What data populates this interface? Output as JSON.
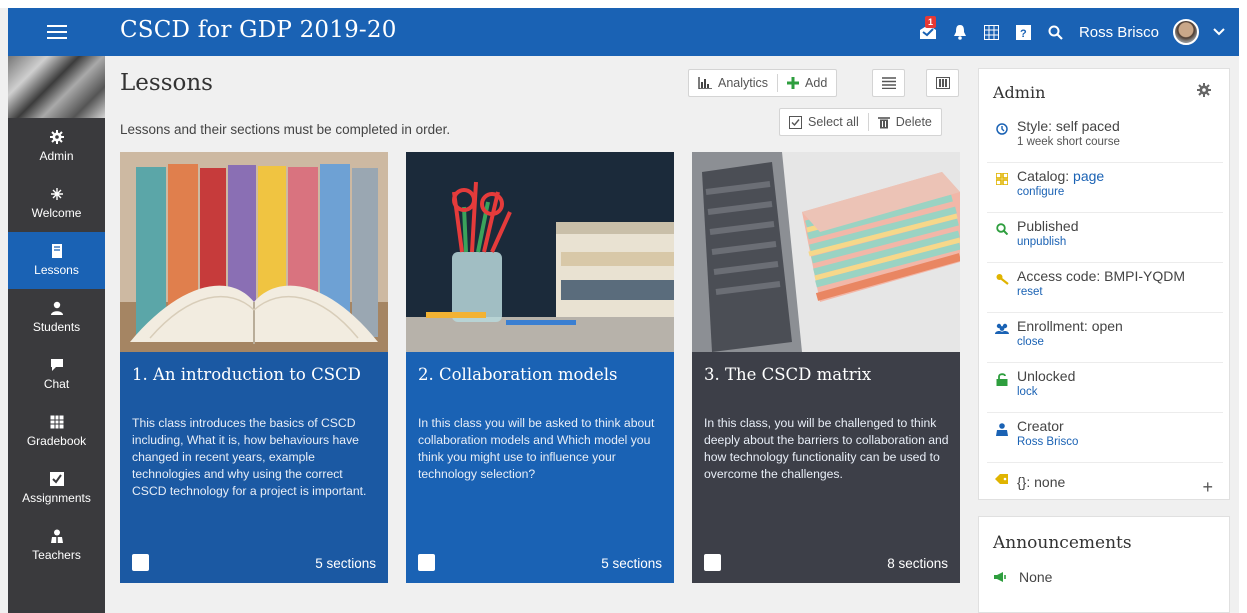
{
  "header": {
    "app_title": "CSCD for GDP 2019-20",
    "notification_count": "1",
    "user_name": "Ross Brisco"
  },
  "sidebar": {
    "items": [
      {
        "label": "Admin",
        "icon": "gear-icon"
      },
      {
        "label": "Welcome",
        "icon": "sparkle-icon"
      },
      {
        "label": "Lessons",
        "icon": "book-icon",
        "active": true
      },
      {
        "label": "Students",
        "icon": "person-icon"
      },
      {
        "label": "Chat",
        "icon": "chat-icon"
      },
      {
        "label": "Gradebook",
        "icon": "grid-icon"
      },
      {
        "label": "Assignments",
        "icon": "checkbox-icon"
      },
      {
        "label": "Teachers",
        "icon": "teacher-icon"
      }
    ]
  },
  "main": {
    "title": "Lessons",
    "subtitle": "Lessons and their sections must be completed in order.",
    "toolbar": {
      "analytics_label": "Analytics",
      "add_label": "Add",
      "select_all_label": "Select all",
      "delete_label": "Delete"
    },
    "lessons": [
      {
        "title": "1. An introduction to CSCD",
        "description": "This class introduces the basics of CSCD including, What it is, how behaviours have changed in recent years, example technologies and why using the correct CSCD technology for a project is important.",
        "sections": "5 sections"
      },
      {
        "title": "2. Collaboration models",
        "description": "In this class you will be asked to think about collaboration models and Which model you think you might use to influence your technology selection?",
        "sections": "5 sections"
      },
      {
        "title": "3. The CSCD matrix",
        "description": "In this class, you will be challenged to think deeply about the barriers to collaboration and how technology functionality can be used to overcome the challenges.",
        "sections": "8 sections"
      }
    ]
  },
  "admin_panel": {
    "title": "Admin",
    "style_label": "Style: self paced",
    "style_sub": "1 week short course",
    "catalog_prefix": "Catalog: ",
    "catalog_link": "page",
    "catalog_action": "configure",
    "published_label": "Published",
    "published_action": "unpublish",
    "access_code_label": "Access code: BMPI-YQDM",
    "access_code_action": "reset",
    "enrollment_label": "Enrollment: open",
    "enrollment_action": "close",
    "unlocked_label": "Unlocked",
    "unlocked_action": "lock",
    "creator_label": "Creator",
    "creator_name": "Ross Brisco",
    "tags_label": "{}: none"
  },
  "announcements": {
    "title": "Announcements",
    "value": "None"
  },
  "colors": {
    "brand_blue": "#1a62b4",
    "sidebar_dark": "#3a3a3d",
    "card_dark": "#3d3f48",
    "icon_blue": "#1a62b4",
    "icon_yellow": "#e0b400",
    "icon_green": "#2e9e3e"
  }
}
